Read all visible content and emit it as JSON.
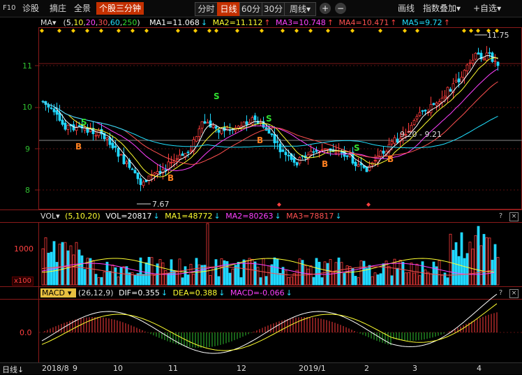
{
  "toolbar": {
    "f10": "F10",
    "diagnose": "诊股",
    "shapes": "摘庄",
    "overview": "全景",
    "stock_3min": "个股三分钟",
    "periods": [
      "分时",
      "日线",
      "60分",
      "30分"
    ],
    "active_period": "日线",
    "week": "周线",
    "week_arrow": "▾",
    "add": "+",
    "minus": "−",
    "draw": "画线",
    "overlay": "指数叠加",
    "overlay_arrow": "▾",
    "watchlist": "+自选",
    "watchlist_arrow": "▾"
  },
  "ma_header": {
    "name": "MA▾",
    "params_open": "(",
    "p5": "5",
    "p10": "10",
    "p20": "20",
    "p30": "30",
    "p60": "60",
    "p250": "250",
    "params_close": ")",
    "ma1": "MA1=11.068",
    "ma1_dir": "↓",
    "ma2": "MA2=11.112",
    "ma2_dir": "↑",
    "ma3": "MA3=10.748",
    "ma3_dir": "↑",
    "ma4": "MA4=10.471",
    "ma4_dir": "↑",
    "ma5": "MA5=9.72",
    "ma5_dir": "↑"
  },
  "vol_header": {
    "name": "VOL▾",
    "params": "(5,10,20)",
    "vol": "VOL=20817",
    "vol_dir": "↓",
    "ma1": "MA1=48772",
    "ma1_dir": "↓",
    "ma2": "MA2=80263",
    "ma2_dir": "↓",
    "ma3": "MA3=78817",
    "ma3_dir": "↓",
    "unit": "x100"
  },
  "macd_header": {
    "name": "MACD",
    "name_arrow": "▾",
    "params": "(26,12,9)",
    "dif": "DIF=0.355",
    "dif_dir": "↓",
    "dea": "DEA=0.388",
    "dea_dir": "↓",
    "macd": "MACD=-0.066",
    "macd_dir": "↓"
  },
  "panel_buttons": {
    "help": "?",
    "close": "×"
  },
  "price_axis": [
    "11",
    "10",
    "9",
    "8"
  ],
  "vol_axis": [
    "1000"
  ],
  "macd_axis": [
    "0.0"
  ],
  "annotations": {
    "high": "11.75",
    "low": "7.67",
    "range": "9.20 - 9.21"
  },
  "signals": {
    "buy": "B",
    "sell": "S"
  },
  "bottom": {
    "period_label": "日线",
    "period_arrow": "↓",
    "dates": [
      "2018/8",
      "9",
      "10",
      "11",
      "12",
      "2019/1",
      "2",
      "3",
      "4"
    ]
  },
  "colors": {
    "up": "#ff3c3c",
    "down": "#20d8ff",
    "ma5": "#ffffff",
    "ma10": "#ffff30",
    "ma20": "#ff40ff",
    "ma30": "#ff5050",
    "ma60": "#20e0ff",
    "dif": "#ffffff",
    "dea": "#ffff30"
  }
}
